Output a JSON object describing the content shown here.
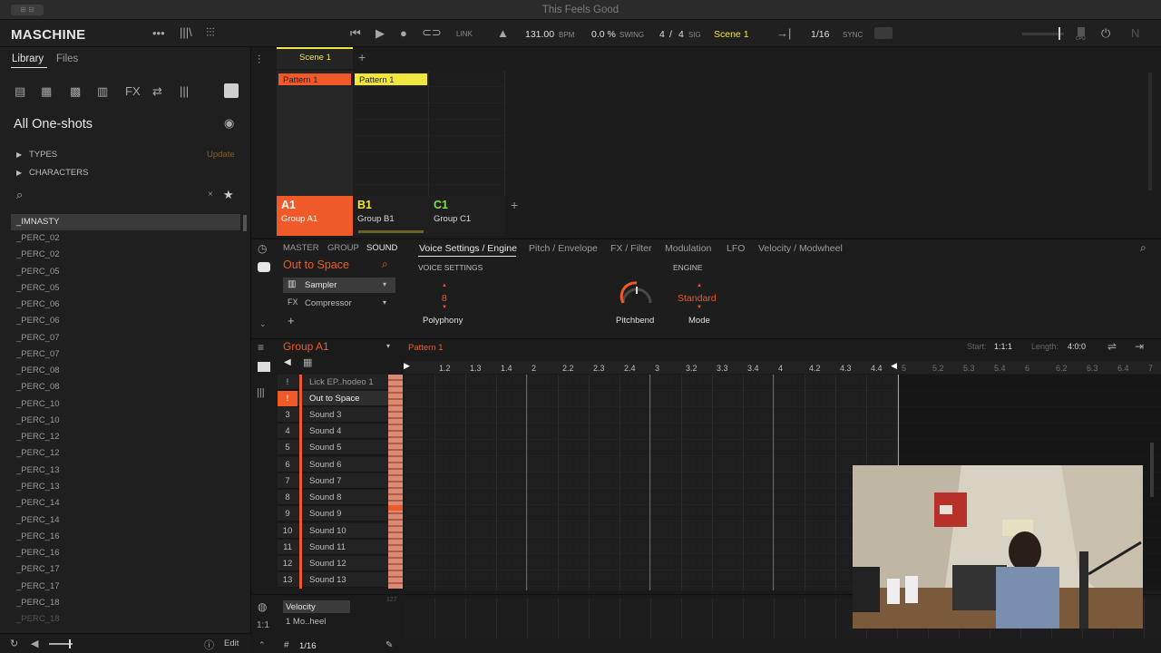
{
  "window": {
    "title": "This Feels Good",
    "badge": "⊞ ⊟"
  },
  "toolbar": {
    "app_name": "MASCHINE",
    "link_label": "LINK",
    "tempo_value": "131.00",
    "tempo_unit": "BPM",
    "swing_value": "0.0 %",
    "swing_label": "SWING",
    "sig_num": "4",
    "sig_sep": "/",
    "sig_den": "4",
    "sig_label": "SIG",
    "scene": "Scene 1",
    "grid": "1/16",
    "sync_label": "SYNC",
    "cpu_label": "CPU",
    "accent": "#f0e640"
  },
  "sidebar": {
    "tabs": [
      "Library",
      "Files"
    ],
    "heading": "All One-shots",
    "filters": [
      {
        "label": "TYPES",
        "action": "Update"
      },
      {
        "label": "CHARACTERS"
      }
    ],
    "items": [
      "_IMNASTY",
      "_PERC_02",
      "_PERC_02",
      "_PERC_05",
      "_PERC_05",
      "_PERC_06",
      "_PERC_06",
      "_PERC_07",
      "_PERC_07",
      "_PERC_08",
      "_PERC_08",
      "_PERC_10",
      "_PERC_10",
      "_PERC_12",
      "_PERC_12",
      "_PERC_13",
      "_PERC_13",
      "_PERC_14",
      "_PERC_14",
      "_PERC_16",
      "_PERC_16",
      "_PERC_17",
      "_PERC_17",
      "_PERC_18",
      "_PERC_18"
    ],
    "footer_edit": "Edit"
  },
  "arranger": {
    "scene_tab": "Scene 1",
    "patterns": [
      "Pattern 1",
      "Pattern 1"
    ],
    "groups": [
      {
        "letter": "A1",
        "name": "Group A1",
        "color": "#f05a28"
      },
      {
        "letter": "B1",
        "name": "Group B1",
        "color": "#f0e640"
      },
      {
        "letter": "C1",
        "name": "Group C1",
        "color": "#7ee04c"
      }
    ]
  },
  "module": {
    "level_tabs": [
      "MASTER",
      "GROUP",
      "SOUND"
    ],
    "sound_name": "Out to Space",
    "slots": [
      "Sampler",
      "Compressor"
    ],
    "page_tabs": [
      "Voice Settings / Engine",
      "Pitch / Envelope",
      "FX / Filter",
      "Modulation",
      "LFO",
      "Velocity / Modwheel"
    ],
    "voice_settings_label": "VOICE SETTINGS",
    "engine_label": "ENGINE",
    "polyphony_value": "8",
    "polyphony_label": "Polyphony",
    "pitchbend_label": "Pitchbend",
    "mode_value": "Standard",
    "mode_label": "Mode"
  },
  "pattern_editor": {
    "group_name": "Group A1",
    "pattern_name": "Pattern 1",
    "start_label": "Start:",
    "start_value": "1:1:1",
    "length_label": "Length:",
    "length_value": "4:0:0",
    "ruler": [
      "1.2",
      "1.3",
      "1.4",
      "2",
      "2.2",
      "2.3",
      "2.4",
      "3",
      "3.2",
      "3.3",
      "3.4",
      "4",
      "4.2",
      "4.3",
      "4.4",
      "5",
      "5.2",
      "5.3",
      "5.4",
      "6",
      "6.2",
      "6.3",
      "6.4",
      "7"
    ],
    "sounds": [
      {
        "num": "!",
        "name": "Lick EP..hodeo 1"
      },
      {
        "num": "!",
        "name": "Out to Space"
      },
      {
        "num": "3",
        "name": "Sound 3"
      },
      {
        "num": "4",
        "name": "Sound 4"
      },
      {
        "num": "5",
        "name": "Sound 5"
      },
      {
        "num": "6",
        "name": "Sound 6"
      },
      {
        "num": "7",
        "name": "Sound 7"
      },
      {
        "num": "8",
        "name": "Sound 8"
      },
      {
        "num": "9",
        "name": "Sound 9"
      },
      {
        "num": "10",
        "name": "Sound 10"
      },
      {
        "num": "11",
        "name": "Sound 11"
      },
      {
        "num": "12",
        "name": "Sound 12"
      },
      {
        "num": "13",
        "name": "Sound 13"
      }
    ],
    "velocity_label": "Velocity",
    "modwheel_label": "1 Mo..heel",
    "vel_max": "127",
    "grid_value": "1/16"
  }
}
